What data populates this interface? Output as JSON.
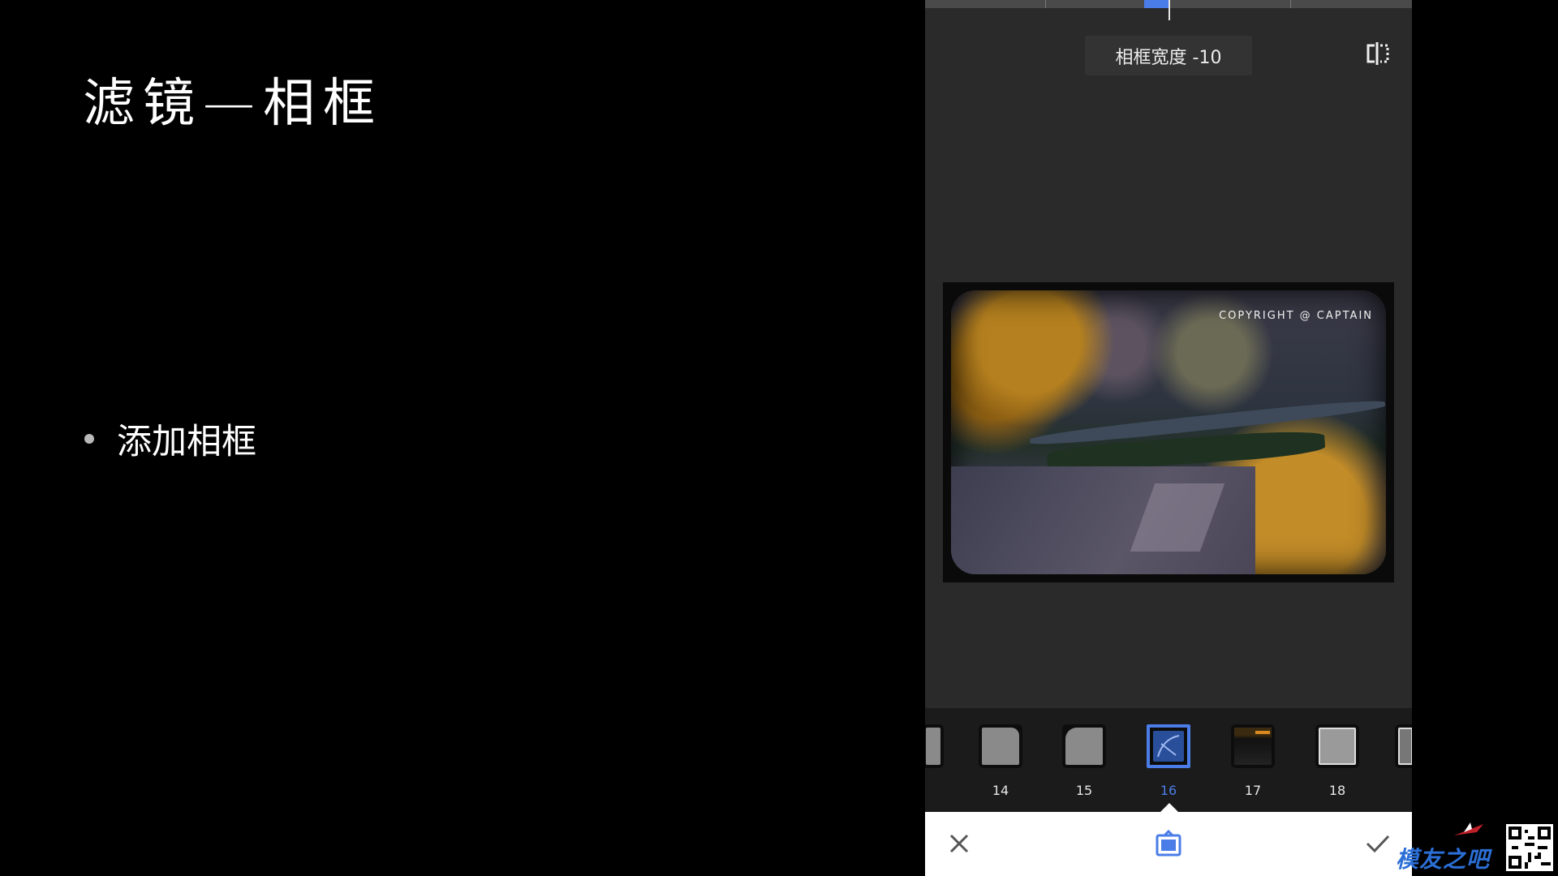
{
  "slide": {
    "title": "滤镜—相框",
    "bullets": [
      "添加相框"
    ]
  },
  "editor": {
    "parameter_label": "相框宽度 -10",
    "photo_watermark": "COPYRIGHT @ CAPTAIN",
    "frames": [
      {
        "number": "",
        "style": "partial"
      },
      {
        "number": "14",
        "style": "rounded-corner"
      },
      {
        "number": "15",
        "style": "soft-corner"
      },
      {
        "number": "16",
        "style": "film-scratch",
        "selected": true
      },
      {
        "number": "17",
        "style": "film-strip"
      },
      {
        "number": "18",
        "style": "white-border"
      },
      {
        "number": "",
        "style": "partial"
      }
    ],
    "accent_color": "#4a7de8",
    "icons": {
      "cancel": "close-icon",
      "tool": "frame-tool-icon",
      "apply": "checkmark-icon",
      "compare": "compare-split-icon"
    }
  },
  "logo": {
    "text": "模友之吧"
  }
}
